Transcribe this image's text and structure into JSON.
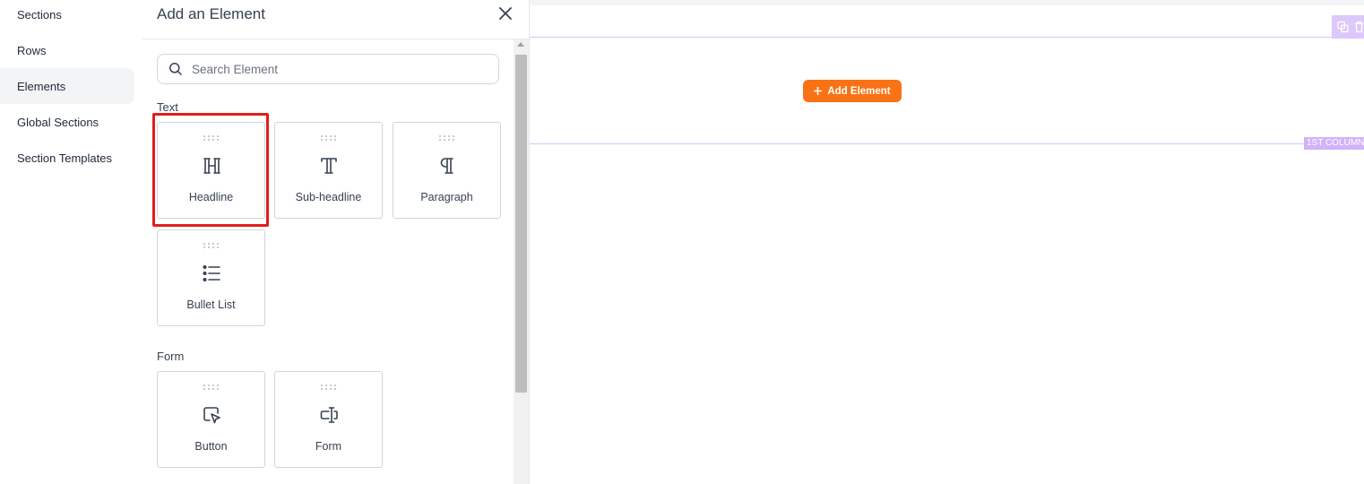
{
  "nav": {
    "items": [
      {
        "label": "Sections"
      },
      {
        "label": "Rows"
      },
      {
        "label": "Elements",
        "active": true
      },
      {
        "label": "Global Sections"
      },
      {
        "label": "Section Templates"
      }
    ]
  },
  "panel": {
    "title": "Add an Element",
    "search_placeholder": "Search Element",
    "groups": [
      {
        "label": "Text",
        "elements": [
          {
            "label": "Headline",
            "icon": "headline-icon"
          },
          {
            "label": "Sub-headline",
            "icon": "subheadline-icon"
          },
          {
            "label": "Paragraph",
            "icon": "paragraph-icon"
          },
          {
            "label": "Bullet List",
            "icon": "bullet-list-icon"
          }
        ]
      },
      {
        "label": "Form",
        "elements": [
          {
            "label": "Button",
            "icon": "button-cursor-icon"
          },
          {
            "label": "Form",
            "icon": "form-input-icon"
          }
        ]
      }
    ]
  },
  "canvas": {
    "add_element_label": "Add Element",
    "column_badge": "1ST COLUMN"
  },
  "colors": {
    "accent": "#f97316",
    "guide": "#d8c4f4",
    "highlight": "#e11d1d"
  }
}
